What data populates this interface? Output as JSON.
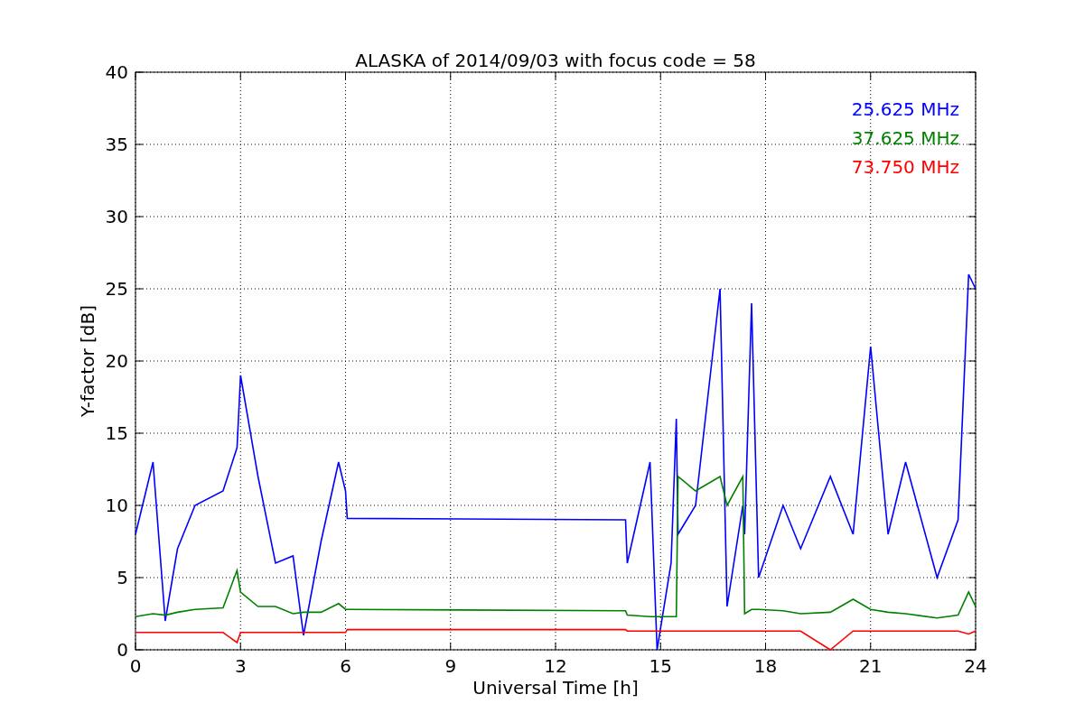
{
  "chart_data": {
    "type": "line",
    "grid": true,
    "title": "ALASKA of 2014/09/03 with focus code = 58",
    "xlabel": "Universal Time [h]",
    "ylabel": "Y-factor [dB]",
    "x": [
      0,
      0.5,
      0.85,
      1.2,
      1.7,
      2.5,
      2.9,
      3.0,
      3.5,
      4.0,
      4.5,
      4.8,
      5.3,
      5.8,
      6.0,
      6.05,
      14.0,
      14.05,
      14.7,
      14.9,
      15.3,
      15.45,
      15.5,
      16.0,
      16.7,
      16.9,
      17.35,
      17.4,
      17.6,
      17.8,
      18.5,
      19.0,
      19.85,
      20.5,
      21.0,
      21.5,
      22.0,
      22.9,
      23.5,
      23.8,
      24.0
    ],
    "series": [
      {
        "name": "25.625 MHz",
        "color": "#0000ff",
        "values": [
          8,
          13,
          2,
          7,
          10,
          11,
          14,
          19,
          12,
          6,
          6.5,
          1,
          7.5,
          13,
          11,
          9.1,
          9,
          6,
          13,
          0,
          6,
          16,
          8,
          10,
          25,
          3,
          10,
          8,
          24,
          5,
          10,
          7,
          12,
          8,
          21,
          8,
          13,
          5,
          9,
          26,
          25
        ]
      },
      {
        "name": "37.625 MHz",
        "color": "#008000",
        "values": [
          2.3,
          2.5,
          2.4,
          2.6,
          2.8,
          2.9,
          5.5,
          4,
          3,
          3,
          2.5,
          2.6,
          2.6,
          3.2,
          2.8,
          2.8,
          2.7,
          2.4,
          2.3,
          2.3,
          2.3,
          2.3,
          12,
          11,
          12,
          10,
          12,
          2.5,
          2.8,
          2.8,
          2.7,
          2.5,
          2.6,
          3.5,
          2.8,
          2.6,
          2.5,
          2.2,
          2.4,
          4,
          3
        ]
      },
      {
        "name": "73.750 MHz",
        "color": "#ff0000",
        "values": [
          1.2,
          1.2,
          1.2,
          1.2,
          1.2,
          1.2,
          0.5,
          1.2,
          1.2,
          1.2,
          1.2,
          1.2,
          1.2,
          1.2,
          1.2,
          1.4,
          1.4,
          1.3,
          1.3,
          1.3,
          1.3,
          1.3,
          1.3,
          1.3,
          1.3,
          1.3,
          1.3,
          1.3,
          1.3,
          1.3,
          1.3,
          1.3,
          0,
          1.3,
          1.3,
          1.3,
          1.3,
          1.3,
          1.3,
          1.1,
          1.3
        ]
      }
    ],
    "xlim": [
      0,
      24
    ],
    "ylim": [
      0,
      40
    ],
    "xticks": [
      0,
      3,
      6,
      9,
      12,
      15,
      18,
      21,
      24
    ],
    "yticks": [
      0,
      5,
      10,
      15,
      20,
      25,
      30,
      35,
      40
    ]
  }
}
